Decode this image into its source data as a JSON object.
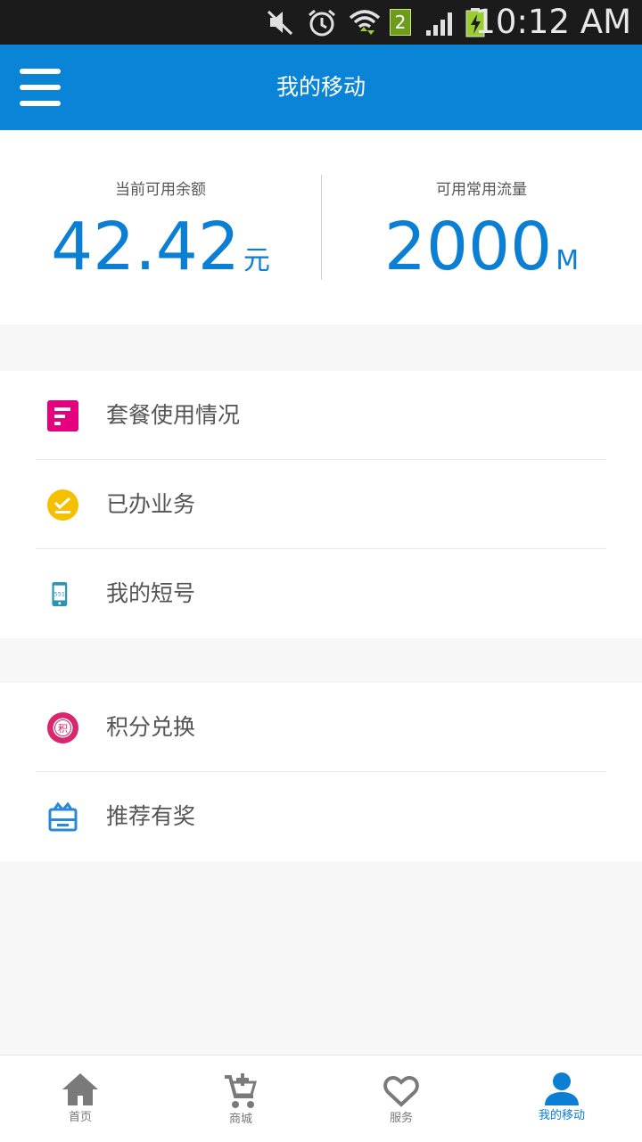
{
  "status_bar": {
    "time": "10:12 AM",
    "sim_badge": "2"
  },
  "header": {
    "title": "我的移动"
  },
  "summary": {
    "balance": {
      "label": "当前可用余额",
      "value": "42.42",
      "unit": "元"
    },
    "data": {
      "label": "可用常用流量",
      "value": "2000",
      "unit": "M"
    }
  },
  "group1": [
    {
      "label": "套餐使用情况",
      "icon": "package-usage-icon",
      "color": "#e5007e"
    },
    {
      "label": "已办业务",
      "icon": "completed-business-icon",
      "color": "#f5c000"
    },
    {
      "label": "我的短号",
      "icon": "short-number-phone-icon",
      "color": "#2a93b8"
    }
  ],
  "group2": [
    {
      "label": "积分兑换",
      "icon": "points-exchange-icon",
      "color": "#d9266e"
    },
    {
      "label": "推荐有奖",
      "icon": "referral-reward-icon",
      "color": "#2a88d8"
    }
  ],
  "bottom_nav": {
    "tabs": [
      {
        "label": "首页",
        "icon": "home-icon"
      },
      {
        "label": "商城",
        "icon": "cart-icon"
      },
      {
        "label": "服务",
        "icon": "heart-icon"
      },
      {
        "label": "我的移动",
        "icon": "user-icon"
      }
    ],
    "active_index": 3
  },
  "colors": {
    "brand": "#0a84d6",
    "value_blue": "#0a7fd4",
    "background": "#f7f7f7"
  }
}
